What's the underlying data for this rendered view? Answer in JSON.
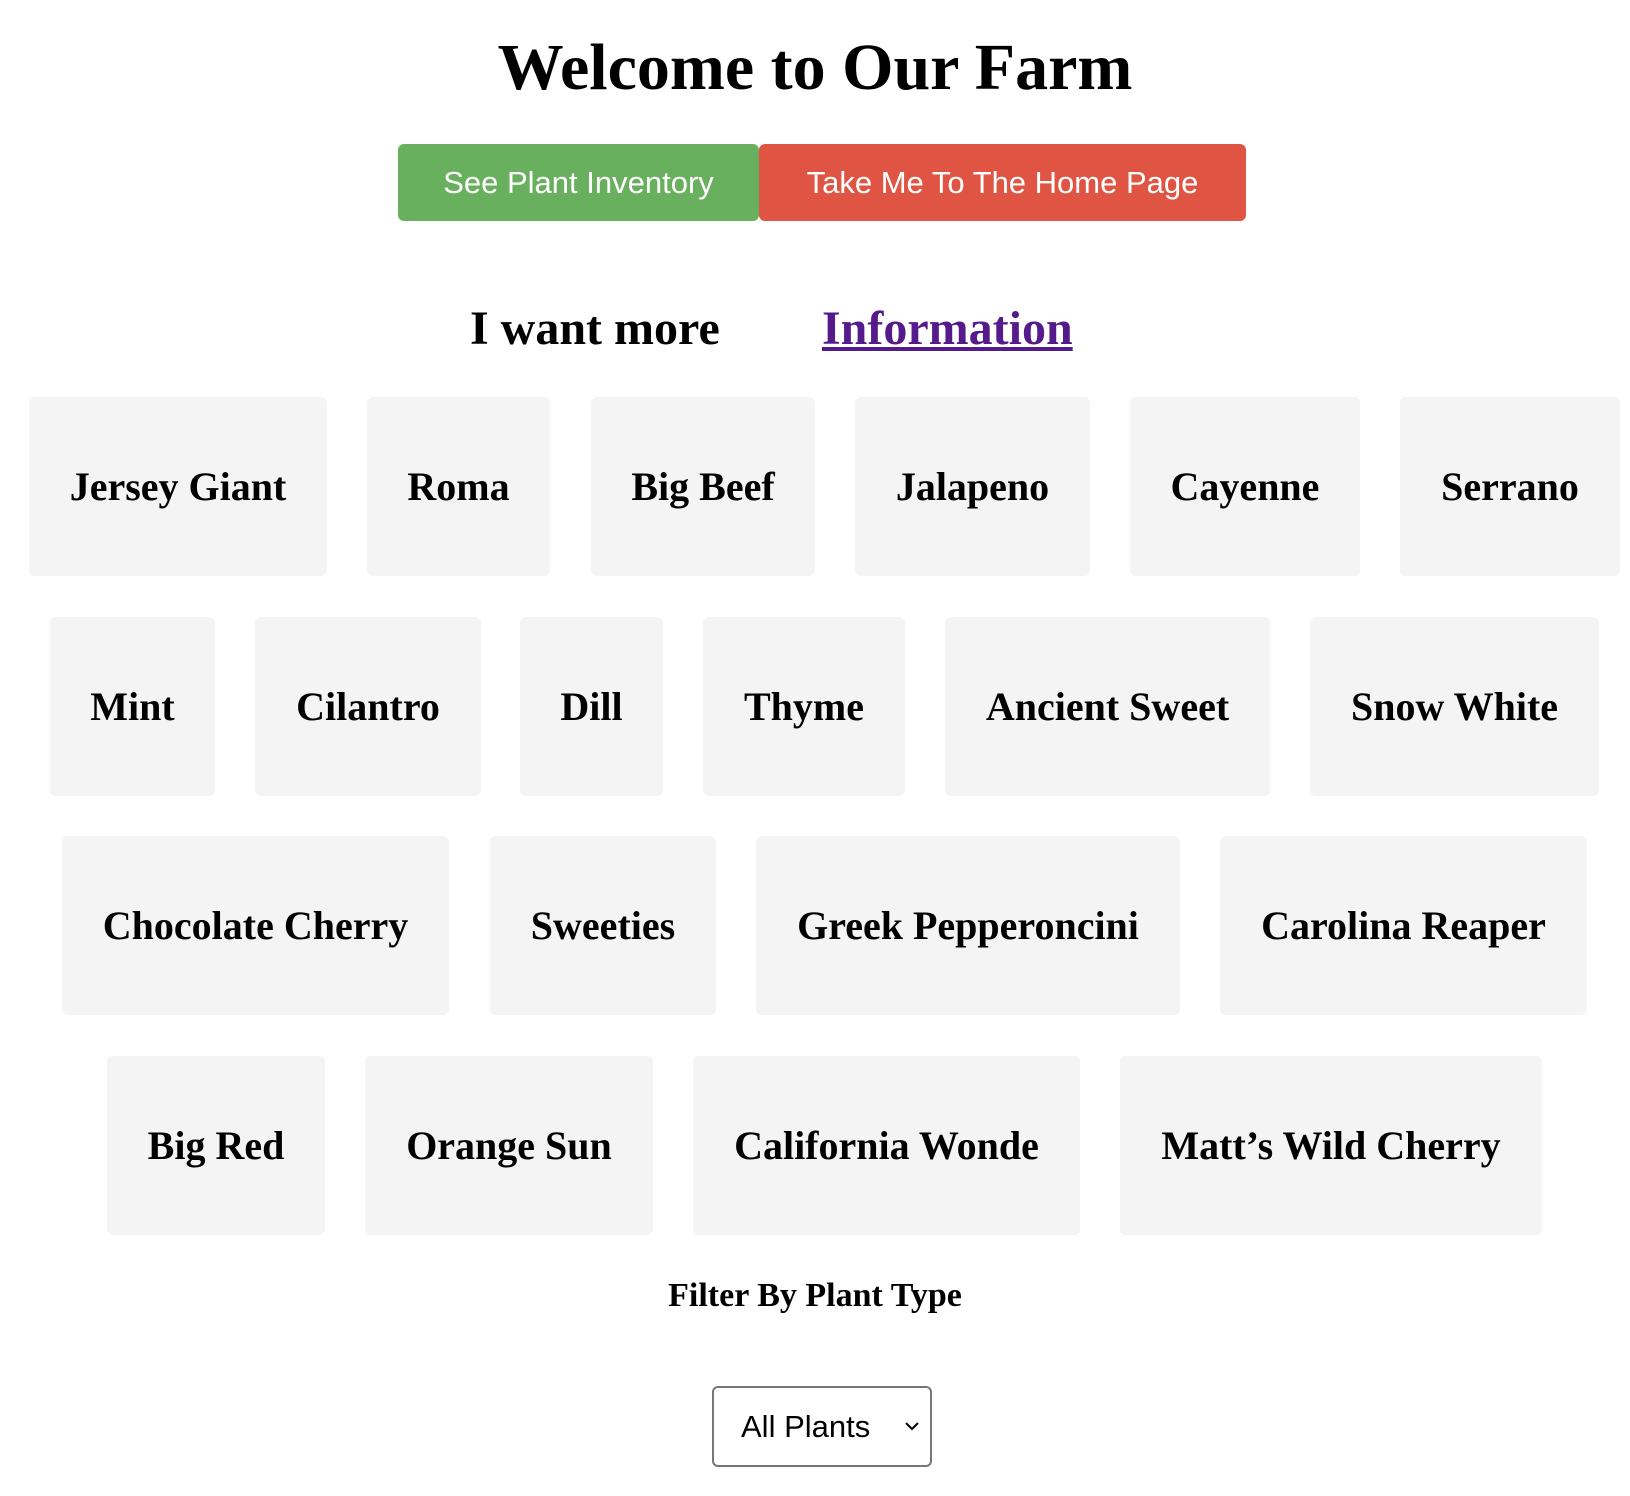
{
  "header": {
    "title": "Welcome to Our Farm"
  },
  "buttons": {
    "inventory_label": "See Plant Inventory",
    "home_label": "Take Me To The Home Page",
    "inventory_color": "#69b05e",
    "home_color": "#e05444"
  },
  "more_info": {
    "text": "I want more",
    "link_label": "Information"
  },
  "plants": [
    "Jersey Giant",
    "Roma",
    "Big Beef",
    "Jalapeno",
    "Cayenne",
    "Serrano",
    "Mint",
    "Cilantro",
    "Dill",
    "Thyme",
    "Ancient Sweet",
    "Snow White",
    "Chocolate Cherry",
    "Sweeties",
    "Greek Pepperoncini",
    "Carolina Reaper",
    "Big Red",
    "Orange Sun",
    "California Wonde",
    "Matt’s Wild Cherry"
  ],
  "filter": {
    "label": "Filter By Plant Type",
    "selected": "All Plants",
    "chevron_icon": "chevron-down-icon"
  }
}
